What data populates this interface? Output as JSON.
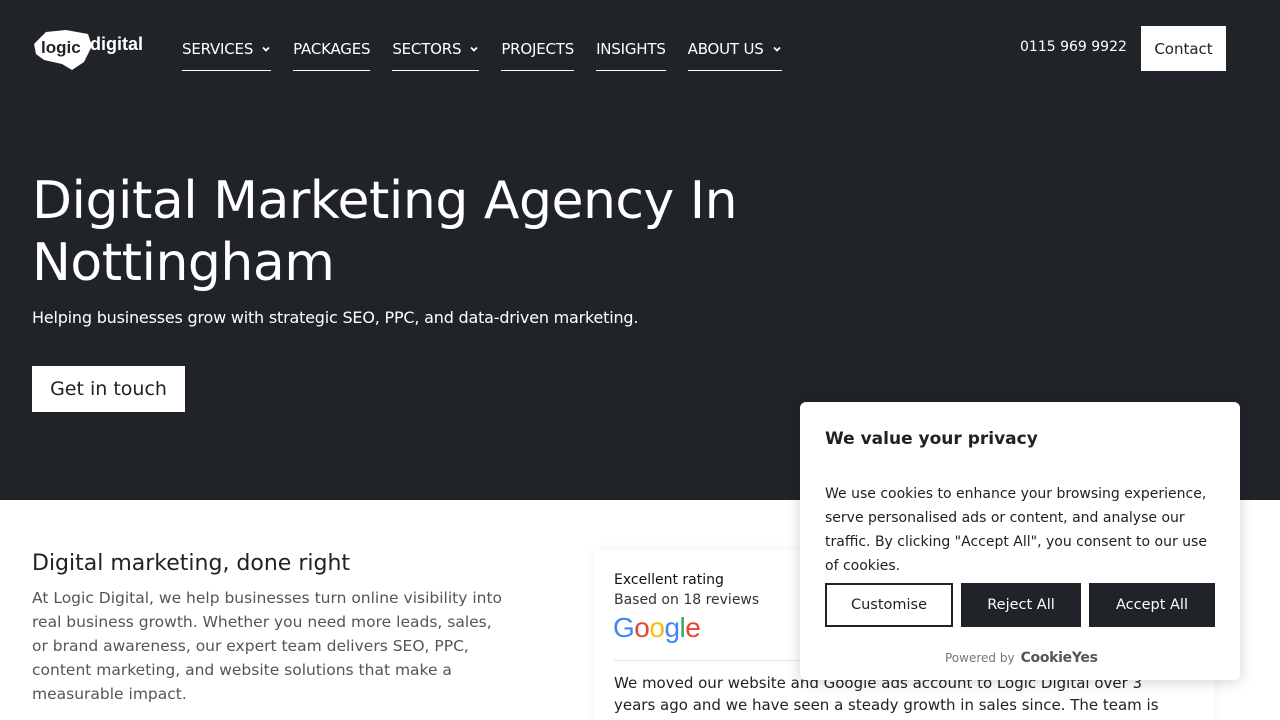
{
  "header": {
    "logo_text": "logic digital",
    "nav": [
      {
        "label": "SERVICES",
        "dropdown": true
      },
      {
        "label": "PACKAGES",
        "dropdown": false
      },
      {
        "label": "SECTORS",
        "dropdown": true
      },
      {
        "label": "PROJECTS",
        "dropdown": false
      },
      {
        "label": "INSIGHTS",
        "dropdown": false
      },
      {
        "label": "ABOUT US",
        "dropdown": true
      }
    ],
    "phone": "0115 969 9922",
    "contact_label": "Contact"
  },
  "hero": {
    "title_line1": "Digital Marketing Agency In",
    "title_line2": "Nottingham",
    "subtitle": "Helping businesses grow with strategic SEO, PPC, and data-driven marketing.",
    "cta_label": "Get in touch"
  },
  "intro": {
    "heading": "Digital marketing, done right",
    "body": "At Logic Digital, we help businesses turn online visibility into real business growth. Whether you need more leads, sales, or brand awareness, our expert team delivers SEO, PPC, content marketing, and website solutions that make a measurable impact."
  },
  "reviews": {
    "rating_label": "Excellent rating",
    "count_label": "Based on 18 reviews",
    "provider": "Google",
    "review_text": "We moved our website and Google ads account to Logic Digital over 3 years ago and we have seen a steady growth in sales since. The team is very proactive"
  },
  "cookie_banner": {
    "title": "We value your privacy",
    "text": "We use cookies to enhance your browsing experience, serve personalised ads or content, and analyse our traffic. By clicking \"Accept All\", you consent to our use of cookies.",
    "customise_label": "Customise",
    "reject_label": "Reject All",
    "accept_label": "Accept All",
    "powered_by": "Powered by",
    "brand": "CookieYes"
  },
  "colors": {
    "hero_bg": "#202428",
    "button_dark": "#202428",
    "google_blue": "#4285F4",
    "google_red": "#EA4335",
    "google_yellow": "#FBBC05",
    "google_green": "#34A853"
  }
}
